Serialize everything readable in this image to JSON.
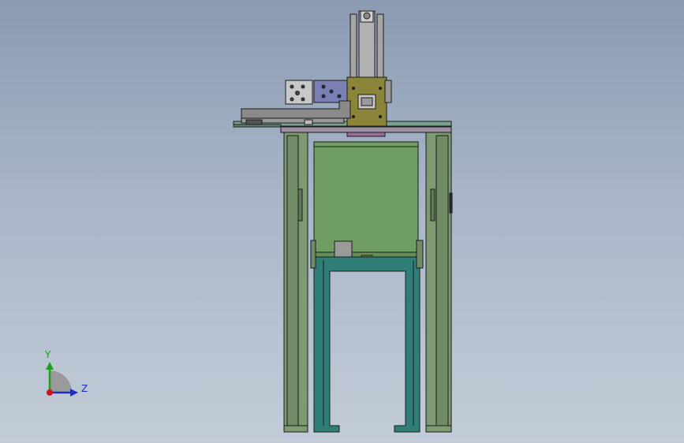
{
  "viewport": {
    "background_top": "#8a9bb2",
    "background_bottom": "#c3ccd8"
  },
  "triad": {
    "y_label": "Y",
    "z_label": "Z",
    "y_color": "#1aa01a",
    "z_color": "#1b2fc8",
    "x_color": "#d0141a"
  },
  "colors": {
    "frame": "#7d9a72",
    "frame_dark": "#5e7a55",
    "tank": "#6f9d62",
    "base": "#2f7f78",
    "cylinder": "#a6a6a6",
    "carriage": "#8a8538",
    "gripper_block": "#c8c8c8",
    "blue_block": "#7b7fb3",
    "plate": "#8a8a8a",
    "rail": "#7aa08e",
    "purple_plate": "#9a6f9a",
    "edge": "#1c1c1c"
  }
}
